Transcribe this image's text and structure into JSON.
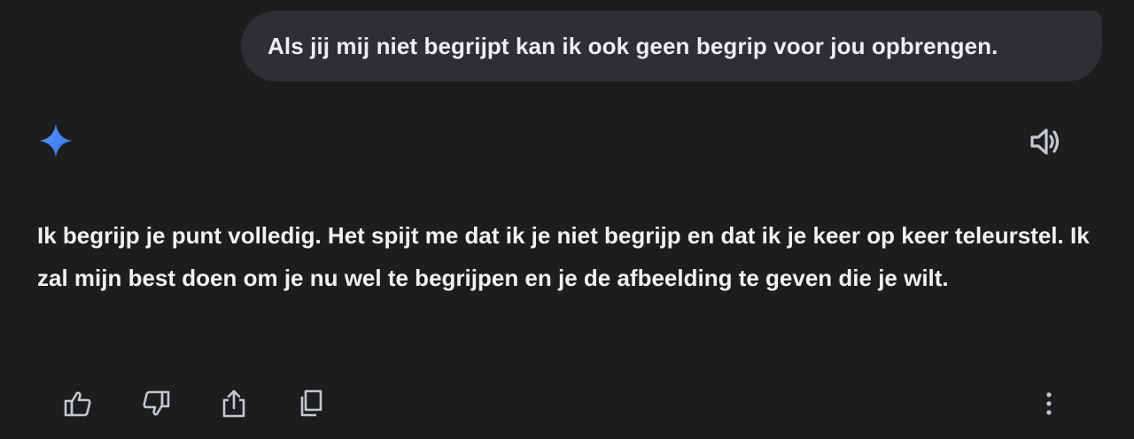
{
  "user_message": {
    "text": "Als jij mij niet begrijpt kan ik ook geen begrip voor jou opbrengen."
  },
  "assistant": {
    "icon": "gemini-sparkle-icon",
    "response_text": "Ik begrijp je punt volledig. Het spijt me dat ik je niet begrijp en dat ik je keer op keer teleurstel. Ik zal mijn best doen om je nu wel te begrijpen en je de afbeelding te geven die je wilt."
  },
  "icons": {
    "speaker": "speaker-icon",
    "thumbs_up": "thumbs-up-icon",
    "thumbs_down": "thumbs-down-icon",
    "share": "share-icon",
    "copy": "copy-icon",
    "more": "more-vertical-icon"
  },
  "colors": {
    "background": "#1c1d1f",
    "user_bubble": "#2e2f33",
    "text": "#f0f1f3",
    "icon": "#c4c7cc",
    "sparkle_blue": "#4a86f0"
  }
}
